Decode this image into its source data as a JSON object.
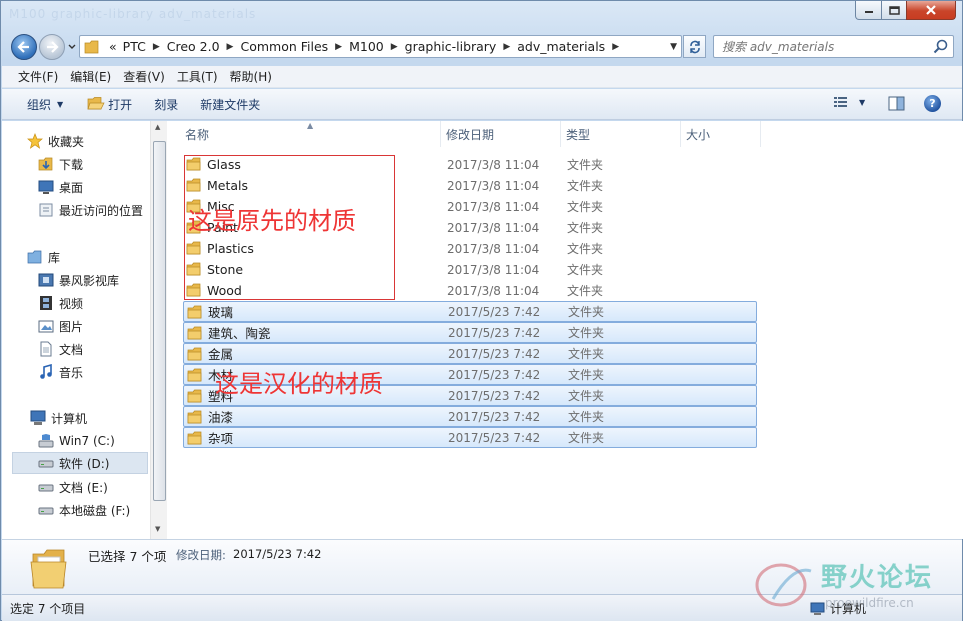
{
  "window": {
    "title": "M100 graphic-library adv_materials"
  },
  "address": {
    "overflow_label": "«",
    "crumbs": [
      "PTC",
      "Creo 2.0",
      "Common Files",
      "M100",
      "graphic-library",
      "adv_materials"
    ]
  },
  "search": {
    "placeholder": "搜索 adv_materials"
  },
  "menu": [
    "文件(F)",
    "编辑(E)",
    "查看(V)",
    "工具(T)",
    "帮助(H)"
  ],
  "commands": {
    "organize": "组织",
    "open": "打开",
    "burn": "刻录",
    "new_folder": "新建文件夹"
  },
  "nav": {
    "favorites": "收藏夹",
    "downloads": "下载",
    "desktop": "桌面",
    "recent": "最近访问的位置",
    "libraries": "库",
    "storm_video": "暴风影视库",
    "videos": "视频",
    "pictures": "图片",
    "documents": "文档",
    "music": "音乐",
    "computer": "计算机",
    "drive_c": "Win7 (C:)",
    "drive_d": "软件 (D:)",
    "drive_e": "文档 (E:)",
    "drive_f": "本地磁盘 (F:)"
  },
  "columns": {
    "name": "名称",
    "date": "修改日期",
    "type": "类型",
    "size": "大小"
  },
  "files": [
    {
      "name": "Glass",
      "date": "2017/3/8 11:04",
      "type": "文件夹",
      "selected": false
    },
    {
      "name": "Metals",
      "date": "2017/3/8 11:04",
      "type": "文件夹",
      "selected": false
    },
    {
      "name": "Misc",
      "date": "2017/3/8 11:04",
      "type": "文件夹",
      "selected": false
    },
    {
      "name": "Paint",
      "date": "2017/3/8 11:04",
      "type": "文件夹",
      "selected": false
    },
    {
      "name": "Plastics",
      "date": "2017/3/8 11:04",
      "type": "文件夹",
      "selected": false
    },
    {
      "name": "Stone",
      "date": "2017/3/8 11:04",
      "type": "文件夹",
      "selected": false
    },
    {
      "name": "Wood",
      "date": "2017/3/8 11:04",
      "type": "文件夹",
      "selected": false
    },
    {
      "name": "玻璃",
      "date": "2017/5/23 7:42",
      "type": "文件夹",
      "selected": true
    },
    {
      "name": "建筑、陶瓷",
      "date": "2017/5/23 7:42",
      "type": "文件夹",
      "selected": true
    },
    {
      "name": "金属",
      "date": "2017/5/23 7:42",
      "type": "文件夹",
      "selected": true
    },
    {
      "name": "木材",
      "date": "2017/5/23 7:42",
      "type": "文件夹",
      "selected": true
    },
    {
      "name": "塑料",
      "date": "2017/5/23 7:42",
      "type": "文件夹",
      "selected": true
    },
    {
      "name": "油漆",
      "date": "2017/5/23 7:42",
      "type": "文件夹",
      "selected": true
    },
    {
      "name": "杂项",
      "date": "2017/5/23 7:42",
      "type": "文件夹",
      "selected": true
    }
  ],
  "annotations": {
    "original": "这是原先的材质",
    "localized": "这是汉化的材质"
  },
  "details": {
    "selected_count": "已选择 7 个项",
    "modified_label": "修改日期:",
    "modified_value": "2017/5/23 7:42"
  },
  "status": {
    "text": "选定 7 个项目",
    "location": "计算机"
  },
  "watermark": {
    "text": "野火论坛",
    "url": "proewildfire.cn"
  },
  "colors": {
    "selection": "#d6e8fb",
    "selection_border": "#84acdd",
    "annotation": "#ee3535",
    "folder": "#e8b84a"
  }
}
